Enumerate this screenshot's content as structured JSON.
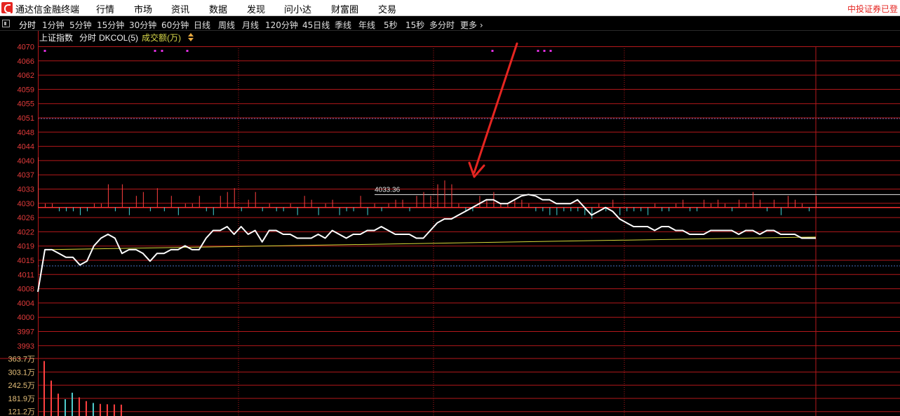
{
  "app": {
    "title": "通达信金融终端",
    "broker": "中投证券已登"
  },
  "menu": [
    "行情",
    "市场",
    "资讯",
    "数据",
    "发现",
    "问小达",
    "财富圈",
    "交易"
  ],
  "periods": {
    "items": [
      "分时",
      "1分钟",
      "5分钟",
      "15分钟",
      "30分钟",
      "60分钟",
      "日线",
      "周线",
      "月线",
      "120分钟",
      "45日线",
      "季线",
      "年线",
      "5秒",
      "15秒",
      "多分时",
      "更多"
    ],
    "active": "分时"
  },
  "chart_header": {
    "index_name": "上证指数",
    "view": "分时",
    "indicator": "DKCOL(5)",
    "volume_label": "成交额(万)"
  },
  "colors": {
    "grid": "#b4181b",
    "axis_text": "#e23b3b",
    "price_line": "#ffffff",
    "avg_line": "#d8d83a",
    "up": "#ff3f3f",
    "down": "#3fd5d5",
    "arrow": "#e52521",
    "magenta": "#e02ee0"
  },
  "chart_data": {
    "type": "line",
    "price_ticks": [
      "4070",
      "4066",
      "4062",
      "4059",
      "4055",
      "4051",
      "4048",
      "4044",
      "4040",
      "4037",
      "4033",
      "4030",
      "4026",
      "4022",
      "4019",
      "4015",
      "4011",
      "4008",
      "4004",
      "4000",
      "3997",
      "3993"
    ],
    "price_range": [
      3991,
      4072
    ],
    "prev_close": 4030,
    "price_series": [
      4008,
      4019,
      4019,
      4018,
      4017,
      4017,
      4015,
      4016,
      4020,
      4022,
      4023,
      4022,
      4018,
      4019,
      4019,
      4018,
      4016,
      4018,
      4018,
      4019,
      4019,
      4020,
      4019,
      4019,
      4022,
      4024,
      4024,
      4025,
      4023,
      4025,
      4023,
      4024,
      4021,
      4024,
      4024,
      4023,
      4023,
      4022,
      4022,
      4022,
      4023,
      4022,
      4024,
      4023,
      4022,
      4023,
      4023,
      4024,
      4024,
      4025,
      4024,
      4023,
      4023,
      4023,
      4022,
      4022,
      4024,
      4026,
      4027,
      4027,
      4028,
      4029,
      4030,
      4031,
      4032,
      4032,
      4031,
      4031,
      4032,
      4033,
      4033.36,
      4033,
      4032,
      4032,
      4031,
      4031,
      4031,
      4032,
      4030,
      4028,
      4029,
      4030,
      4029,
      4027,
      4026,
      4025,
      4025,
      4025,
      4024,
      4025,
      4025,
      4024,
      4024,
      4023,
      4023,
      4023,
      4024,
      4024,
      4024,
      4024,
      4023,
      4024,
      4024,
      4023,
      4024,
      4024,
      4023,
      4023,
      4023,
      4022,
      4022,
      4022
    ],
    "avg_series_endpoints": [
      4019,
      4022.3
    ],
    "bars": [
      13,
      1,
      1,
      -1,
      -1,
      -1,
      -2,
      -1,
      1,
      1,
      6,
      -1,
      6,
      -2,
      3,
      4,
      -1,
      5,
      -1,
      3,
      -2,
      1,
      1,
      3,
      -1,
      -2,
      3,
      4,
      5,
      -1,
      2,
      4,
      -1,
      1,
      -1,
      -1,
      1,
      -2,
      3,
      2,
      -2,
      1,
      2,
      -2,
      -1,
      -1,
      3,
      -2,
      1,
      -1,
      1,
      2,
      2,
      -1,
      3,
      4,
      3,
      6,
      7,
      6,
      1,
      -1,
      -1,
      3,
      2,
      4,
      1,
      1,
      2,
      2,
      1,
      -1,
      -1,
      -2,
      -2,
      -1,
      -1,
      -1,
      -2,
      -3,
      1,
      -1,
      2,
      -2,
      -1,
      -1,
      -1,
      -2,
      1,
      -1,
      -1,
      1,
      2,
      -1,
      -1,
      2,
      1,
      2,
      1,
      -1,
      2,
      1,
      4,
      2,
      -1,
      2,
      -2,
      3,
      2,
      1,
      -1,
      3
    ],
    "marked_high": "4033.36",
    "volume_ticks": [
      "363.7万",
      "303.1万",
      "242.5万",
      "181.9万",
      "121.2万"
    ],
    "volume_range": [
      60,
      365
    ],
    "volume_series": [
      355,
      250,
      180,
      150,
      185,
      160,
      140,
      130,
      125,
      123,
      122,
      121
    ]
  }
}
